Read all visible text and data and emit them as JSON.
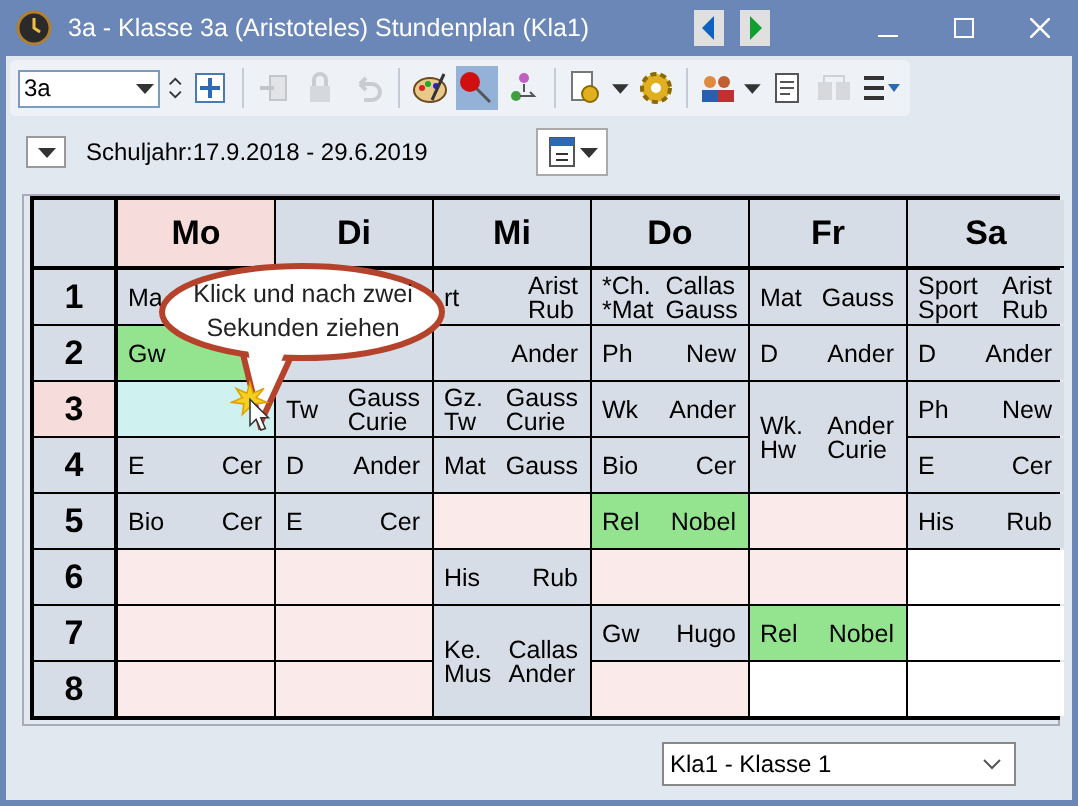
{
  "window": {
    "title": "3a - Klasse 3a (Aristoteles)  Stundenplan  (Kla1)"
  },
  "toolbar": {
    "class_field": "3a",
    "buttons": [
      {
        "selected": false,
        "disabled": false
      },
      {
        "selected": false,
        "disabled": true
      },
      {
        "selected": false,
        "disabled": true
      },
      {
        "selected": false,
        "disabled": true
      },
      {
        "selected": false,
        "disabled": false
      },
      {
        "selected": true,
        "disabled": false
      },
      {
        "selected": false,
        "disabled": false
      },
      {
        "selected": false,
        "disabled": false
      },
      {
        "selected": false,
        "disabled": false
      },
      {
        "selected": false,
        "disabled": false
      },
      {
        "selected": false,
        "disabled": false
      },
      {
        "selected": false,
        "disabled": true
      },
      {
        "selected": false,
        "disabled": false
      }
    ]
  },
  "school_year": "Schuljahr:17.9.2018 - 29.6.2019",
  "timetable": {
    "days": [
      {
        "label": "Mo",
        "selected": true
      },
      {
        "label": "Di",
        "selected": false
      },
      {
        "label": "Mi",
        "selected": false
      },
      {
        "label": "Do",
        "selected": false
      },
      {
        "label": "Fr",
        "selected": false
      },
      {
        "label": "Sa",
        "selected": false
      }
    ],
    "periods": [
      {
        "label": "1",
        "selected": false
      },
      {
        "label": "2",
        "selected": false
      },
      {
        "label": "3",
        "selected": true
      },
      {
        "label": "4",
        "selected": false
      },
      {
        "label": "5",
        "selected": false
      },
      {
        "label": "6",
        "selected": false
      },
      {
        "label": "7",
        "selected": false
      },
      {
        "label": "8",
        "selected": false
      }
    ],
    "columns": [
      [
        {
          "kind": "lesson",
          "subjects": [
            "Ma"
          ]
        },
        {
          "kind": "highlight",
          "subjects": [
            "Gw"
          ]
        },
        {
          "kind": "selected"
        },
        {
          "kind": "lesson",
          "subjects": [
            "E"
          ],
          "teachers": [
            "Cer"
          ]
        },
        {
          "kind": "lesson",
          "subjects": [
            "Bio"
          ],
          "teachers": [
            "Cer"
          ]
        },
        {
          "kind": "free"
        },
        {
          "kind": "free"
        },
        {
          "kind": "free"
        }
      ],
      [
        {
          "kind": "lesson"
        },
        {
          "kind": "lesson"
        },
        {
          "kind": "lesson",
          "subjects": [
            "Tw"
          ],
          "teachers": [
            "Gauss",
            "Curie"
          ]
        },
        {
          "kind": "lesson",
          "subjects": [
            "D"
          ],
          "teachers": [
            "Ander"
          ]
        },
        {
          "kind": "lesson",
          "subjects": [
            "E"
          ],
          "teachers": [
            "Cer"
          ]
        },
        {
          "kind": "free"
        },
        {
          "kind": "free"
        },
        {
          "kind": "free"
        }
      ],
      [
        {
          "kind": "lesson",
          "subjects": [
            "rt"
          ],
          "teachers": [
            "Arist",
            "Rub"
          ]
        },
        {
          "kind": "lesson",
          "teachers": [
            "Ander"
          ]
        },
        {
          "kind": "lesson",
          "subjects": [
            "Gz.",
            "Tw"
          ],
          "teachers": [
            "Gauss",
            "Curie"
          ]
        },
        {
          "kind": "lesson",
          "subjects": [
            "Mat"
          ],
          "teachers": [
            "Gauss"
          ]
        },
        {
          "kind": "free"
        },
        {
          "kind": "lesson",
          "subjects": [
            "His"
          ],
          "teachers": [
            "Rub"
          ]
        },
        {
          "kind": "double",
          "subjects": [
            "Ke.",
            "Mus"
          ],
          "teachers": [
            "Callas",
            "Ander"
          ]
        }
      ],
      [
        {
          "kind": "lesson",
          "subjects": [
            "*Ch.",
            "*Mat"
          ],
          "teachers": [
            "Callas",
            "Gauss"
          ]
        },
        {
          "kind": "lesson",
          "subjects": [
            "Ph"
          ],
          "teachers": [
            "New"
          ]
        },
        {
          "kind": "lesson",
          "subjects": [
            "Wk"
          ],
          "teachers": [
            "Ander"
          ]
        },
        {
          "kind": "lesson",
          "subjects": [
            "Bio"
          ],
          "teachers": [
            "Cer"
          ]
        },
        {
          "kind": "highlight",
          "subjects": [
            "Rel"
          ],
          "teachers": [
            "Nobel"
          ]
        },
        {
          "kind": "free"
        },
        {
          "kind": "lesson",
          "subjects": [
            "Gw"
          ],
          "teachers": [
            "Hugo"
          ]
        },
        {
          "kind": "free"
        }
      ],
      [
        {
          "kind": "lesson",
          "subjects": [
            "Mat"
          ],
          "teachers": [
            "Gauss"
          ]
        },
        {
          "kind": "lesson",
          "subjects": [
            "D"
          ],
          "teachers": [
            "Ander"
          ]
        },
        {
          "kind": "double",
          "subjects": [
            "Wk.",
            "Hw"
          ],
          "teachers": [
            "Ander",
            "Curie"
          ]
        },
        {
          "kind": "free"
        },
        {
          "kind": "free"
        },
        {
          "kind": "highlight",
          "subjects": [
            "Rel"
          ],
          "teachers": [
            "Nobel"
          ]
        },
        {
          "kind": "empty"
        }
      ],
      [
        {
          "kind": "lesson",
          "subjects": [
            "Sport",
            "Sport"
          ],
          "teachers": [
            "Arist",
            "Rub"
          ]
        },
        {
          "kind": "lesson",
          "subjects": [
            "D"
          ],
          "teachers": [
            "Ander"
          ]
        },
        {
          "kind": "lesson",
          "subjects": [
            "Ph"
          ],
          "teachers": [
            "New"
          ]
        },
        {
          "kind": "lesson",
          "subjects": [
            "E"
          ],
          "teachers": [
            "Cer"
          ]
        },
        {
          "kind": "lesson",
          "subjects": [
            "His"
          ],
          "teachers": [
            "Rub"
          ]
        },
        {
          "kind": "empty"
        },
        {
          "kind": "empty"
        },
        {
          "kind": "empty"
        }
      ]
    ]
  },
  "callout": "Klick und nach zwei Sekunden ziehen",
  "footer": {
    "selector": "Kla1 - Klasse 1"
  }
}
